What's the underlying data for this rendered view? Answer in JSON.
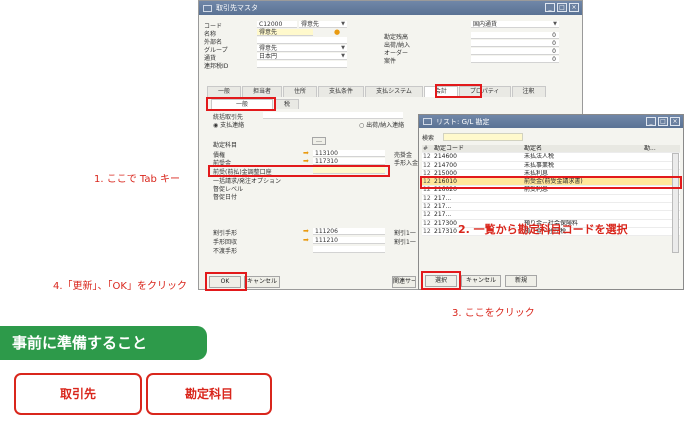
{
  "main_window": {
    "title": "取引先マスタ",
    "labels": [
      "コード",
      "名称",
      "外部名",
      "グループ",
      "通貨",
      "連邦税ID"
    ],
    "code_value": "C12000",
    "code_select": "得意先",
    "name_value": "得意先",
    "group_value": "得意先",
    "currency_value": "日本円",
    "right_select": "国内通貨",
    "right_labels": [
      "勘定残高",
      "出荷/納入",
      "オーダー",
      "案件"
    ],
    "right_values": [
      "0",
      "0",
      "0",
      "0"
    ],
    "tabs": [
      "一般",
      "担当者",
      "住所",
      "支払条件",
      "支払システム",
      "会計",
      "プロパティ",
      "注釈"
    ],
    "subtabs": [
      "一般",
      "税"
    ],
    "section_labels": [
      "統括取引先",
      "支払連絡",
      "勘定科目",
      "債権",
      "前受金",
      "前受(前払)金調整口座",
      "一括請求/発注オプション",
      "督促レベル",
      "督促日付",
      "割引手形",
      "手形回収",
      "不渡手形"
    ],
    "radio_left": "支払連絡",
    "radio_right": "出荷/納入連絡",
    "acct_values": [
      "113100",
      "117310",
      "111206",
      "111210"
    ],
    "right_col_labels": [
      "売掛金",
      "手形入金",
      "割引1一",
      "割引1一"
    ],
    "ok_button": "OK",
    "cancel_button": "キャンセル",
    "related_button": "関連サー"
  },
  "list_window": {
    "title": "リスト: G/L 勘定",
    "search_label": "検索",
    "columns": [
      "#",
      "勘定コード",
      "勘定名",
      "勘..."
    ],
    "rows": [
      {
        "n": "12",
        "code": "214600",
        "name": "未払法人税"
      },
      {
        "n": "12",
        "code": "214700",
        "name": "未払事業税"
      },
      {
        "n": "12",
        "code": "215000",
        "name": "未払利息"
      },
      {
        "n": "12",
        "code": "216010",
        "name": "前受金(前受金請求書)",
        "selected": true
      },
      {
        "n": "12",
        "code": "216020",
        "name": "前受利息"
      },
      {
        "n": "12",
        "code": "217...",
        "name": ""
      },
      {
        "n": "12",
        "code": "217...",
        "name": ""
      },
      {
        "n": "12",
        "code": "217...",
        "name": ""
      },
      {
        "n": "12",
        "code": "217300",
        "name": "預り金－社会保険料"
      },
      {
        "n": "12",
        "code": "217310",
        "name": "預り金－住民税"
      }
    ],
    "select_button": "選択",
    "cancel_button": "キャンセル",
    "new_button": "新規"
  },
  "callouts": {
    "step1": "1. ここで Tab キー",
    "step2": "2. 一覧から勘定科目コードを選択",
    "step3": "3. ここをクリック",
    "step4": "4.「更新」、「OK」をクリック"
  },
  "section": {
    "title": "事前に準備すること",
    "cards": [
      "取引先",
      "勘定科目"
    ]
  }
}
